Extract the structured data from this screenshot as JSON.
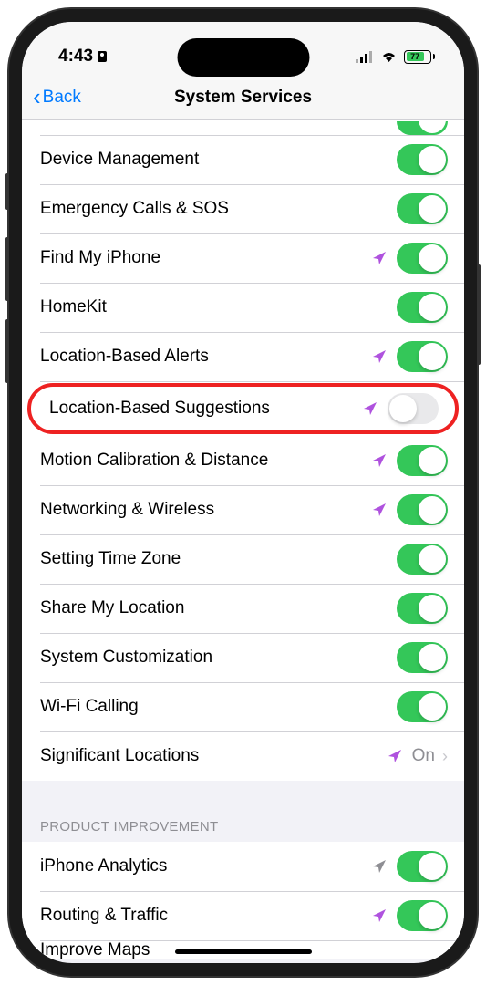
{
  "status": {
    "time": "4:43",
    "battery_pct": "77"
  },
  "nav": {
    "back": "Back",
    "title": "System Services"
  },
  "items": [
    {
      "label": "Device Management",
      "arrow": null,
      "toggle": true
    },
    {
      "label": "Emergency Calls & SOS",
      "arrow": null,
      "toggle": true
    },
    {
      "label": "Find My iPhone",
      "arrow": "purple",
      "toggle": true
    },
    {
      "label": "HomeKit",
      "arrow": null,
      "toggle": true
    },
    {
      "label": "Location-Based Alerts",
      "arrow": "purple",
      "toggle": true
    },
    {
      "label": "Location-Based Suggestions",
      "arrow": "purple",
      "toggle": false,
      "highlight": true
    },
    {
      "label": "Motion Calibration & Distance",
      "arrow": "purple",
      "toggle": true
    },
    {
      "label": "Networking & Wireless",
      "arrow": "purple",
      "toggle": true
    },
    {
      "label": "Setting Time Zone",
      "arrow": null,
      "toggle": true
    },
    {
      "label": "Share My Location",
      "arrow": null,
      "toggle": true
    },
    {
      "label": "System Customization",
      "arrow": null,
      "toggle": true
    },
    {
      "label": "Wi-Fi Calling",
      "arrow": null,
      "toggle": true
    }
  ],
  "significant": {
    "label": "Significant Locations",
    "value": "On"
  },
  "section2_header": "PRODUCT IMPROVEMENT",
  "section2_items": [
    {
      "label": "iPhone Analytics",
      "arrow": "gray",
      "toggle": true
    },
    {
      "label": "Routing & Traffic",
      "arrow": "purple",
      "toggle": true
    }
  ],
  "partial_label": "Improve Maps"
}
